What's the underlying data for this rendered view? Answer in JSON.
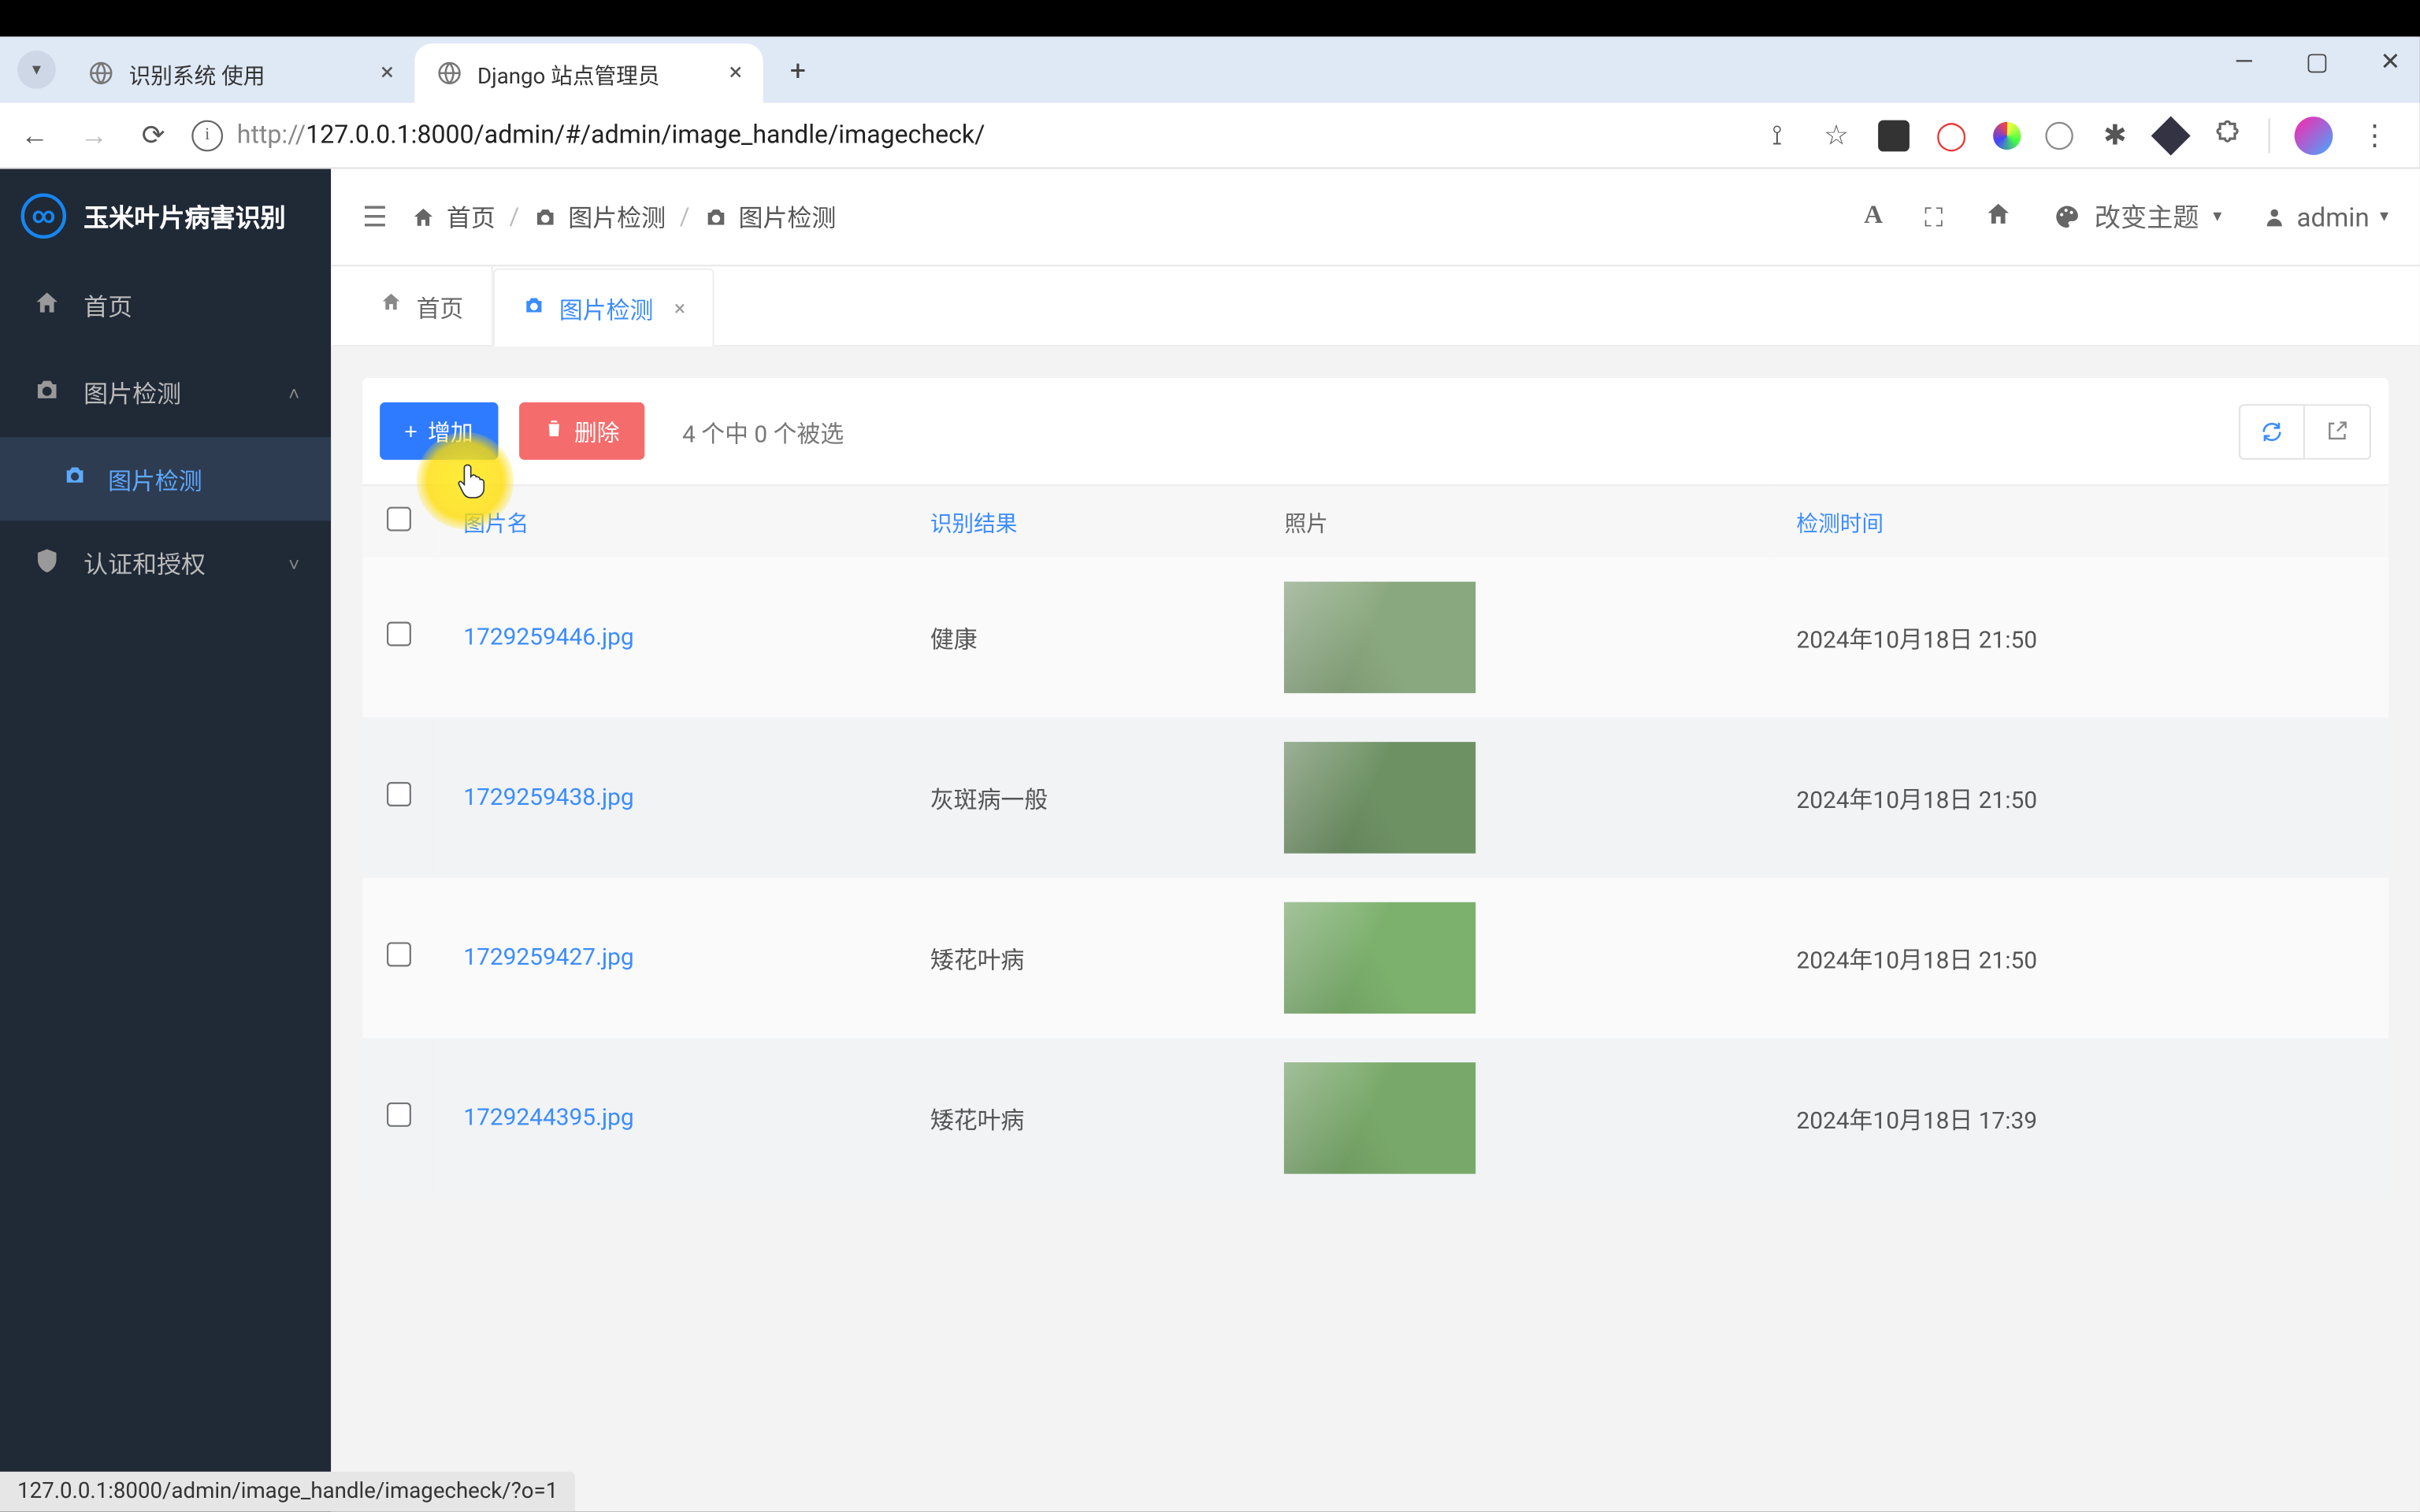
{
  "browser": {
    "tabs": [
      {
        "title": "识别系统 使用",
        "active": false
      },
      {
        "title": "Django 站点管理员",
        "active": true
      }
    ],
    "url_proto": "http://",
    "url_rest": "127.0.0.1:8000/admin/#/admin/image_handle/imagecheck/"
  },
  "sidebar": {
    "app_title": "玉米叶片病害识别",
    "items": [
      {
        "icon": "home",
        "label": "首页"
      },
      {
        "icon": "camera",
        "label": "图片检测",
        "expandable": true,
        "open": true,
        "children": [
          {
            "label": "图片检测",
            "active": true
          }
        ]
      },
      {
        "icon": "shield",
        "label": "认证和授权",
        "expandable": true
      }
    ]
  },
  "topbar": {
    "crumbs": [
      {
        "icon": "home",
        "label": "首页"
      },
      {
        "icon": "camera",
        "label": "图片检测"
      },
      {
        "icon": "camera",
        "label": "图片检测"
      }
    ],
    "theme_label": "改变主题",
    "user_label": "admin"
  },
  "pagetabs": [
    {
      "icon": "home",
      "label": "首页",
      "active": false,
      "closable": false
    },
    {
      "icon": "camera",
      "label": "图片检测",
      "active": true,
      "closable": true
    }
  ],
  "toolbar": {
    "add_label": "增加",
    "delete_label": "删除",
    "selection_info": "4 个中 0 个被选"
  },
  "table": {
    "headers": {
      "name": "图片名",
      "result": "识别结果",
      "photo": "照片",
      "time": "检测时间"
    },
    "rows": [
      {
        "name": "1729259446.jpg",
        "result": "健康",
        "thumb_class": "leaf1",
        "time": "2024年10月18日 21:50"
      },
      {
        "name": "1729259438.jpg",
        "result": "灰斑病一般",
        "thumb_class": "leaf2",
        "time": "2024年10月18日 21:50"
      },
      {
        "name": "1729259427.jpg",
        "result": "矮花叶病",
        "thumb_class": "leaf3",
        "time": "2024年10月18日 21:50"
      },
      {
        "name": "1729244395.jpg",
        "result": "矮花叶病",
        "thumb_class": "leaf4",
        "time": "2024年10月18日 17:39"
      }
    ]
  },
  "status_bar": "127.0.0.1:8000/admin/image_handle/imagecheck/?o=1"
}
